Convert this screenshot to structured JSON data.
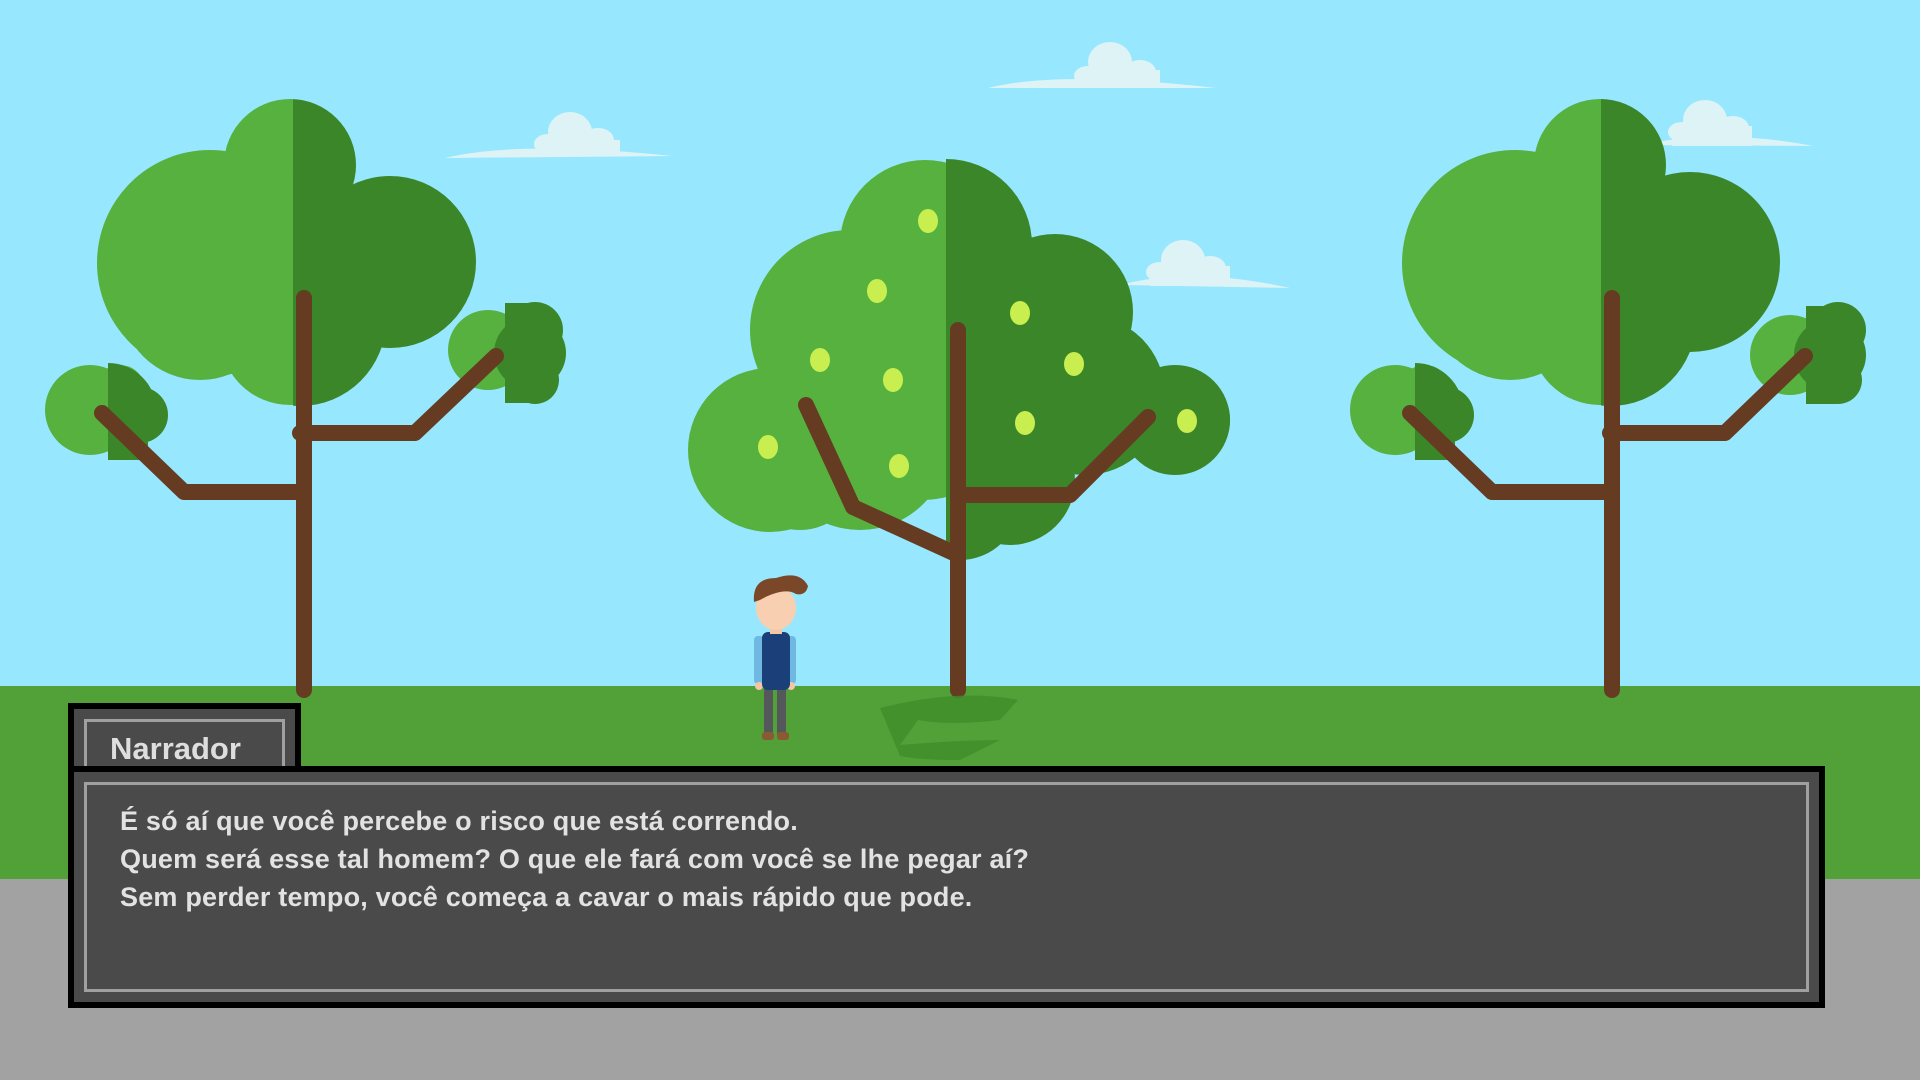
{
  "dialogue": {
    "speaker": "Narrador",
    "lines": [
      "É só aí que você percebe o risco que está correndo.",
      "Quem será esse tal homem? O que ele fará com você se lhe pegar aí?",
      "Sem perder tempo, você começa a cavar o mais rápido que pode."
    ]
  },
  "colors": {
    "sky": "#97e8fe",
    "grass": "#52a038",
    "road": "#a2a2a2",
    "tree_light": "#56b13e",
    "tree_dark": "#3a8628",
    "trunk": "#653c22",
    "fruit": "#c8ef4f",
    "dialog_bg": "#4a4a4a",
    "dialog_border": "#000000",
    "dialog_inner_border": "#a0a0a0"
  }
}
